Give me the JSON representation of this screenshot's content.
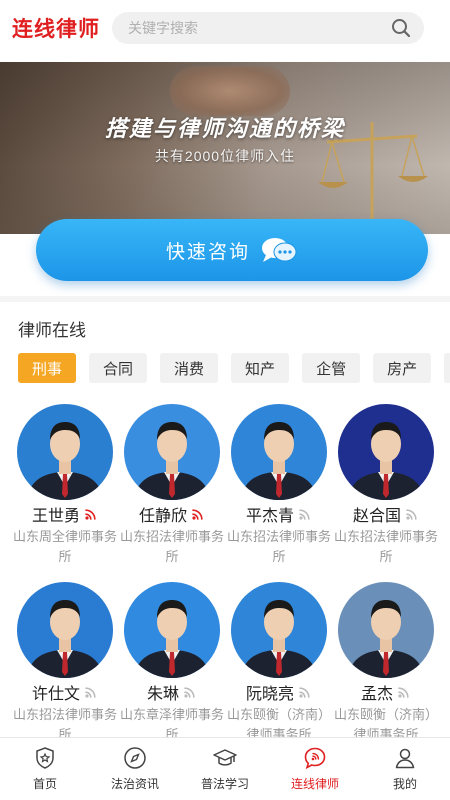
{
  "header": {
    "app_title": "连线律师",
    "search_placeholder": "关键字搜索"
  },
  "banner": {
    "headline": "搭建与律师沟通的桥梁",
    "subline": "共有2000位律师入住"
  },
  "consult": {
    "label": "快速咨询"
  },
  "section": {
    "title": "律师在线"
  },
  "tabs": [
    {
      "label": "刑事",
      "active": true
    },
    {
      "label": "合同"
    },
    {
      "label": "消费"
    },
    {
      "label": "知产"
    },
    {
      "label": "企管"
    },
    {
      "label": "房产"
    },
    {
      "label": ""
    }
  ],
  "lawyers": [
    {
      "name": "王世勇",
      "firm": "山东周全律师事务所",
      "online": true
    },
    {
      "name": "任静欣",
      "firm": "山东招法律师事务所",
      "online": true
    },
    {
      "name": "平杰青",
      "firm": "山东招法律师事务所",
      "online": false
    },
    {
      "name": "赵合国",
      "firm": "山东招法律师事务所",
      "online": false
    },
    {
      "name": "许仕文",
      "firm": "山东招法律师事务所",
      "online": false
    },
    {
      "name": "朱琳",
      "firm": "山东章泽律师事务所",
      "online": false
    },
    {
      "name": "阮晓亮",
      "firm": "山东颐衡（济南）律师事务所",
      "online": false
    },
    {
      "name": "孟杰",
      "firm": "山东颐衡（济南）律师事务所",
      "online": false
    }
  ],
  "nav": [
    {
      "label": "首页",
      "icon": "shield-star-icon"
    },
    {
      "label": "法治资讯",
      "icon": "compass-icon"
    },
    {
      "label": "普法学习",
      "icon": "graduation-cap-icon"
    },
    {
      "label": "连线律师",
      "icon": "chat-signal-icon",
      "active": true
    },
    {
      "label": "我的",
      "icon": "user-icon"
    }
  ],
  "colors": {
    "brand_red": "#e02020",
    "accent_orange": "#f5a623",
    "consult_blue": "#1c95e8",
    "online_red": "#e02020",
    "offline_gray": "#bbbbbb"
  }
}
